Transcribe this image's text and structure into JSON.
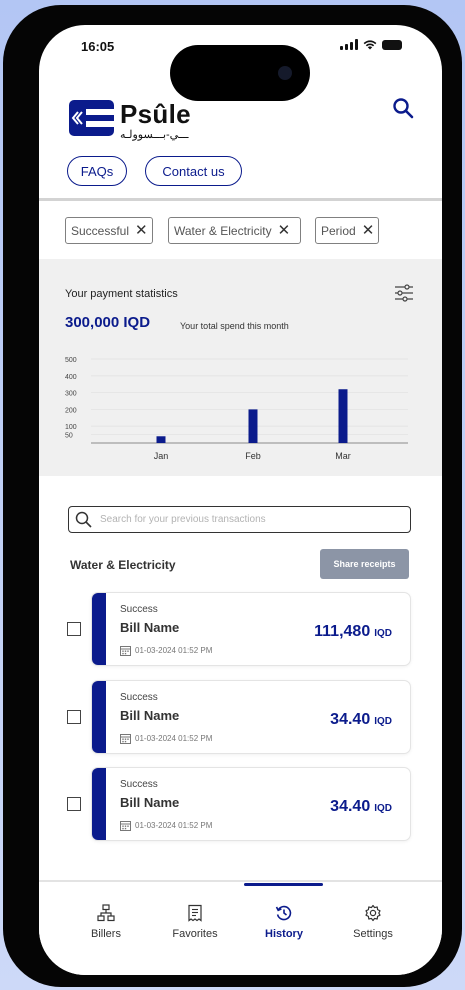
{
  "status_bar": {
    "time": "16:05"
  },
  "brand": {
    "name": "Psûle",
    "subtitle": "ـــي-بـــسوولـه"
  },
  "header_links": {
    "faqs": "FAQs",
    "contact": "Contact us"
  },
  "filters": [
    {
      "label": "Successful"
    },
    {
      "label": "Water & Electricity"
    },
    {
      "label": "Period"
    }
  ],
  "stats": {
    "title": "Your payment statistics",
    "amount": "300,000 IQD",
    "note": "Your total spend this month"
  },
  "chart_data": {
    "type": "bar",
    "categories": [
      "Jan",
      "Feb",
      "Mar"
    ],
    "values": [
      40,
      200,
      320
    ],
    "yticks": [
      50,
      100,
      200,
      300,
      400,
      500
    ],
    "ylim": [
      0,
      500
    ],
    "color": "#0b1b8c"
  },
  "search": {
    "placeholder": "Search for your previous transactions"
  },
  "section": {
    "title": "Water & Electricity",
    "share_label": "Share receipts"
  },
  "transactions": [
    {
      "status": "Success",
      "name": "Bill Name",
      "date": "01-03-2024 01:52 PM",
      "amount": "111,480",
      "currency": "IQD"
    },
    {
      "status": "Success",
      "name": "Bill Name",
      "date": "01-03-2024 01:52 PM",
      "amount": "34.40",
      "currency": "IQD"
    },
    {
      "status": "Success",
      "name": "Bill Name",
      "date": "01-03-2024 01:52 PM",
      "amount": "34.40",
      "currency": "IQD"
    }
  ],
  "nav": {
    "items": [
      {
        "label": "Billers",
        "icon": "sitemap-icon"
      },
      {
        "label": "Favorites",
        "icon": "receipt-icon"
      },
      {
        "label": "History",
        "icon": "history-icon",
        "active": true
      },
      {
        "label": "Settings",
        "icon": "gear-icon"
      }
    ]
  },
  "colors": {
    "accent": "#0b1b8c",
    "share_button": "#8c95a6",
    "stats_bg": "#f0f0f0"
  }
}
